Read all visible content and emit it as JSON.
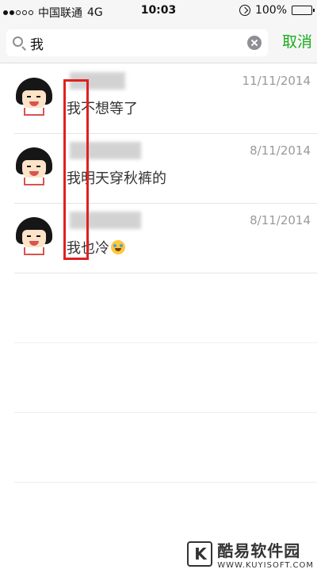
{
  "status_bar": {
    "carrier": "中国联通",
    "network": "4G",
    "time": "10:03",
    "battery": "100%"
  },
  "search": {
    "query": "我",
    "cancel_label": "取消"
  },
  "results": [
    {
      "date": "11/11/2014",
      "message": "我不想等了"
    },
    {
      "date": "8/11/2014",
      "message": "我明天穿秋裤的"
    },
    {
      "date": "8/11/2014",
      "message": "我也冷"
    }
  ],
  "watermark": {
    "title": "酷易软件园",
    "url": "WWW.KUYISOFT.COM"
  },
  "colors": {
    "accent": "#1aad19",
    "highlight": "#e02020"
  }
}
